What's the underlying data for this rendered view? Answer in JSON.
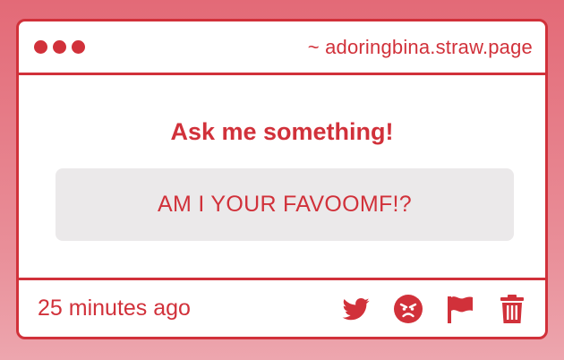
{
  "window": {
    "url": "~ adoringbina.straw.page"
  },
  "main": {
    "title": "Ask me something!",
    "question": "AM I YOUR FAVOOMF!?"
  },
  "footer": {
    "timestamp": "25 minutes ago",
    "actions": [
      {
        "icon": "twitter-icon"
      },
      {
        "icon": "angry-face-icon"
      },
      {
        "icon": "flag-icon"
      },
      {
        "icon": "trash-icon"
      }
    ]
  },
  "colors": {
    "accent": "#d1313a",
    "background": "#e36a77",
    "question_bg": "#ebe9ea"
  }
}
